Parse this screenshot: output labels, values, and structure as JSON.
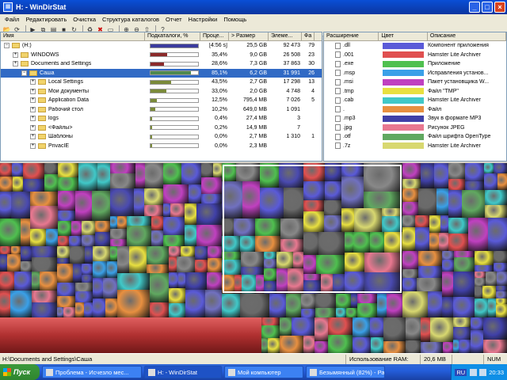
{
  "window": {
    "title": "H: - WinDirStat"
  },
  "menu": [
    "Файл",
    "Редактировать",
    "Очистка",
    "Структура каталогов",
    "Отчет",
    "Настройки",
    "Помощь"
  ],
  "tree": {
    "headers": {
      "name": "Имя",
      "subdirs": "Подкаталоги, %",
      "pct": "Проце...",
      "size": "> Размер",
      "items": "Элеме...",
      "files": "Фа"
    },
    "rows": [
      {
        "name": "(H:)",
        "pct": "[4:56 s]",
        "size": "25,5 GB",
        "items": "92 473",
        "files": "79",
        "fill": 1.0,
        "color": "#3b3b9e",
        "indent": 0,
        "type": "drive"
      },
      {
        "name": "WINDOWS",
        "pct": "35,4%",
        "size": "9,0 GB",
        "items": "26 508",
        "files": "23",
        "fill": 0.354,
        "color": "#8b2a2a",
        "indent": 1
      },
      {
        "name": "Documents and Settings",
        "pct": "28,6%",
        "size": "7,3 GB",
        "items": "37 863",
        "files": "30",
        "fill": 0.286,
        "color": "#8b2a2a",
        "indent": 1
      },
      {
        "name": "Саша",
        "pct": "85,1%",
        "size": "6,2 GB",
        "items": "31 991",
        "files": "26",
        "fill": 0.851,
        "color": "#4f8a4f",
        "indent": 2,
        "selected": true
      },
      {
        "name": "Local Settings",
        "pct": "43,5%",
        "size": "2,7 GB",
        "items": "17 298",
        "files": "13",
        "fill": 0.435,
        "color": "#7a8a3a",
        "indent": 3
      },
      {
        "name": "Мои документы",
        "pct": "33,0%",
        "size": "2,0 GB",
        "items": "4 748",
        "files": "4",
        "fill": 0.33,
        "color": "#7a8a3a",
        "indent": 3
      },
      {
        "name": "Application Data",
        "pct": "12,5%",
        "size": "795,4 MB",
        "items": "7 026",
        "files": "5",
        "fill": 0.125,
        "color": "#7a8a3a",
        "indent": 3
      },
      {
        "name": "Рабочий стол",
        "pct": "10,2%",
        "size": "649,0 MB",
        "items": "1 091",
        "files": "",
        "fill": 0.102,
        "color": "#7a8a3a",
        "indent": 3
      },
      {
        "name": "logs",
        "pct": "0,4%",
        "size": "27,4 MB",
        "items": "3",
        "files": "",
        "fill": 0.004,
        "color": "#7a8a3a",
        "indent": 3
      },
      {
        "name": "<Файлы>",
        "pct": "0,2%",
        "size": "14,9 MB",
        "items": "7",
        "files": "",
        "fill": 0.002,
        "color": "#7a8a3a",
        "indent": 3
      },
      {
        "name": "Шаблоны",
        "pct": "0,0%",
        "size": "2,7 MB",
        "items": "1 310",
        "files": "1",
        "fill": 0.0,
        "color": "#7a8a3a",
        "indent": 3
      },
      {
        "name": "PrivacIE",
        "pct": "0,0%",
        "size": "2,3 MB",
        "items": "",
        "files": "",
        "fill": 0.0,
        "color": "#7a8a3a",
        "indent": 3
      }
    ]
  },
  "extensions": {
    "headers": {
      "ext": "Расширение",
      "color": "Цвет",
      "desc": "Описание"
    },
    "rows": [
      {
        "ext": ".dll",
        "color": "#5a5ad8",
        "desc": "Компонент приложения"
      },
      {
        "ext": ".001",
        "color": "#e05050",
        "desc": "Hamster Lite Archiver"
      },
      {
        "ext": ".exe",
        "color": "#4fc04f",
        "desc": "Приложение"
      },
      {
        "ext": ".msp",
        "color": "#3aa0e8",
        "desc": "Исправления установ..."
      },
      {
        "ext": ".msi",
        "color": "#c040c0",
        "desc": "Пакет установщика W..."
      },
      {
        "ext": ".tmp",
        "color": "#e8e040",
        "desc": "Файл \"TMP\""
      },
      {
        "ext": ".cab",
        "color": "#40c8c8",
        "desc": "Hamster Lite Archiver"
      },
      {
        "ext": ".",
        "color": "#e89040",
        "desc": "Файл"
      },
      {
        "ext": ".mp3",
        "color": "#4040a8",
        "desc": "Звук в формате MP3"
      },
      {
        "ext": ".jpg",
        "color": "#e87890",
        "desc": "Рисунок JPEG"
      },
      {
        "ext": ".otf",
        "color": "#60a860",
        "desc": "Файл шрифта OpenType"
      },
      {
        "ext": ".7z",
        "color": "#d8d870",
        "desc": "Hamster Lite Archiver"
      }
    ]
  },
  "statusbar": {
    "path": "H:\\Documents and Settings\\Саша",
    "ram_label": "Использование RAM:",
    "ram_value": "20,6 MB",
    "num": "NUM"
  },
  "taskbar": {
    "start": "Пуск",
    "tasks": [
      {
        "label": "Проблема - Исчезло мес...",
        "active": false
      },
      {
        "label": "H: - WinDirStat",
        "active": true
      },
      {
        "label": "Мой компьютер",
        "active": false
      },
      {
        "label": "Безымянный (82%) - Ра...",
        "active": false
      }
    ],
    "lang": "RU",
    "time": "20:33"
  }
}
